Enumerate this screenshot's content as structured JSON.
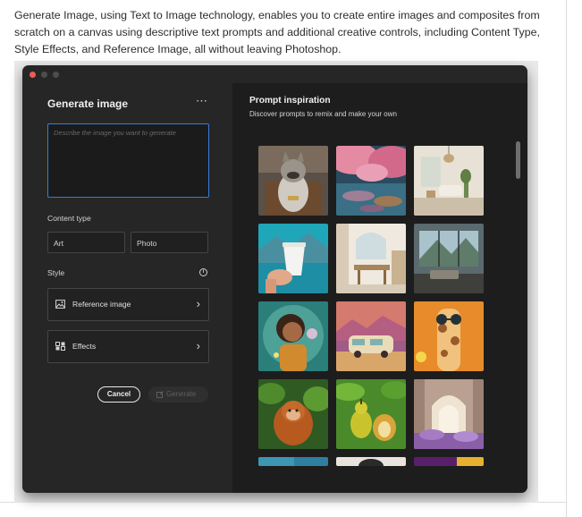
{
  "intro": {
    "text": "Generate Image, using Text to Image technology, enables you to create entire images and composites from scratch on a canvas using descriptive text prompts and additional creative controls, including Content Type, Style Effects, and Reference Image, all without leaving Photoshop."
  },
  "window": {
    "title": "Generate image",
    "more_icon": "more-horizontal-icon",
    "prompt": {
      "value": "",
      "placeholder": "Describe the image you want to generate"
    },
    "content_type": {
      "label": "Content type",
      "options": [
        "Art",
        "Photo"
      ]
    },
    "style": {
      "label": "Style",
      "info_icon": "info-icon",
      "rows": [
        {
          "label": "Reference image",
          "icon": "image-icon"
        },
        {
          "label": "Effects",
          "icon": "effects-icon"
        }
      ]
    },
    "buttons": {
      "cancel": "Cancel",
      "generate": "Generate"
    }
  },
  "inspiration": {
    "title": "Prompt inspiration",
    "subtitle": "Discover prompts to remix and make your own",
    "thumbnails": [
      "bulldog-on-throne",
      "cherry-blossom-lake",
      "living-room-interior",
      "hand-holding-coffee-cup",
      "kitchen-interior",
      "mountain-view-room",
      "girl-with-bubble",
      "retro-camper-van",
      "giraffe-with-sunglasses",
      "orangutan-in-jungle",
      "pears-with-leaves",
      "arched-hallway-flowers",
      "partial-thumbnail-1",
      "partial-thumbnail-2",
      "partial-thumbnail-3"
    ]
  },
  "colors": {
    "accent_focus": "#3b7bd8",
    "panel_dark": "#262626",
    "panel_darker": "#1d1d1d",
    "close_light": "#ee5b54"
  }
}
